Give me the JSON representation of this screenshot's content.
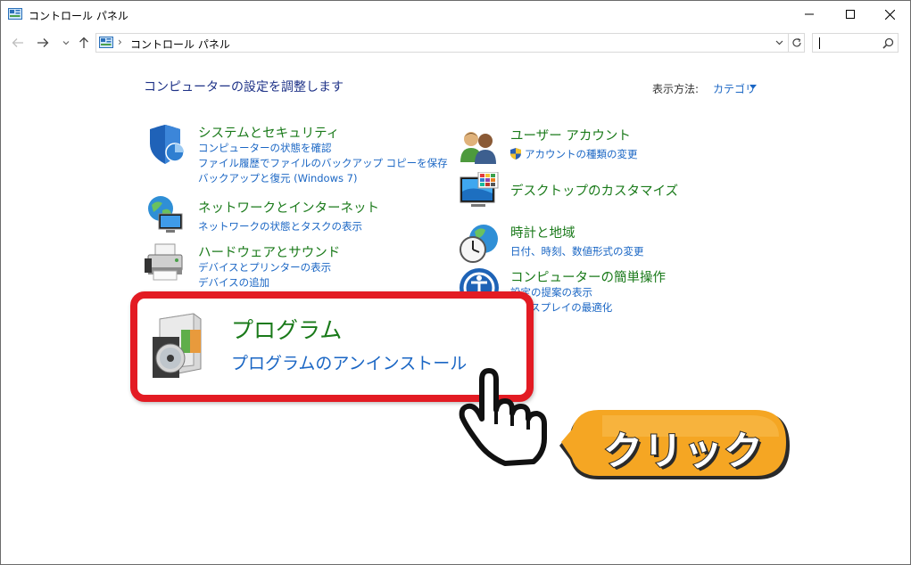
{
  "window": {
    "title": "コントロール パネル",
    "icon": "control-panel-icon"
  },
  "address": {
    "path": "コントロール パネル",
    "separator": "›",
    "search_value": ""
  },
  "content": {
    "heading": "コンピューターの設定を調整します",
    "view_by_label": "表示方法:",
    "view_by_value": "カテゴリ"
  },
  "categories": {
    "system": {
      "title": "システムとセキュリティ",
      "links": [
        "コンピューターの状態を確認",
        "ファイル履歴でファイルのバックアップ コピーを保存",
        "バックアップと復元 (Windows 7)"
      ],
      "icon": "shield-icon"
    },
    "network": {
      "title": "ネットワークとインターネット",
      "links": [
        "ネットワークの状態とタスクの表示"
      ],
      "icon": "network-globe-icon"
    },
    "hardware": {
      "title": "ハードウェアとサウンド",
      "links": [
        "デバイスとプリンターの表示",
        "デバイスの追加"
      ],
      "icon": "printer-icon"
    },
    "programs": {
      "title": "プログラム",
      "links": [
        "プログラムのアンインストール"
      ],
      "icon": "programs-cd-icon"
    },
    "user": {
      "title": "ユーザー アカウント",
      "links": [
        "アカウントの種類の変更"
      ],
      "icon": "users-icon"
    },
    "appearance": {
      "title": "デスクトップのカスタマイズ",
      "links": [],
      "icon": "monitor-colors-icon"
    },
    "clock": {
      "title": "時計と地域",
      "links": [
        "日付、時刻、数値形式の変更"
      ],
      "icon": "clock-globe-icon"
    },
    "ease": {
      "title": "コンピューターの簡単操作",
      "links": [
        "設定の提案の表示",
        "ディスプレイの最適化"
      ],
      "icon": "ease-of-access-icon"
    }
  },
  "annotation": {
    "callout_text": "クリック",
    "highlight_color": "#e31b23",
    "callout_color": "#f5a623",
    "pointer": "hand-pointer-icon"
  },
  "colors": {
    "category_title": "#1a7a1a",
    "link": "#1a66c4",
    "heading": "#1e3287"
  }
}
